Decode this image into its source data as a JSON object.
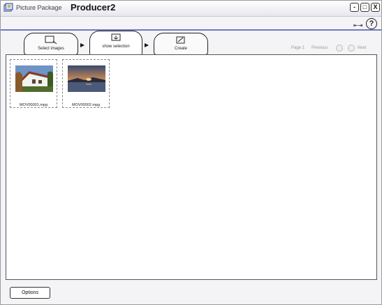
{
  "window": {
    "title_prefix": "Picture Package",
    "title_main": "Producer2",
    "minimize_label": "-",
    "maximize_label": "□",
    "close_label": "X"
  },
  "toolbar": {
    "help_icon": "question-mark-icon",
    "extra_icon": "double-arrow-icon",
    "extra_label": "⇤⇥",
    "help_label": "?"
  },
  "tabs": [
    {
      "label": "Select images",
      "icon": "select-images-icon",
      "active": false
    },
    {
      "label": "show selection",
      "icon": "show-selection-icon",
      "active": true
    },
    {
      "label": "Create",
      "icon": "create-icon",
      "active": false
    }
  ],
  "pager": {
    "page_label": "Page 1",
    "previous_label": "Previous",
    "next_label": "Next"
  },
  "thumbnails": [
    {
      "filename": "MOV00001.mpg",
      "scene": "house-photo"
    },
    {
      "filename": "MOV00002.mpg",
      "scene": "sunset-photo"
    }
  ],
  "bottom": {
    "options_label": "Options"
  }
}
